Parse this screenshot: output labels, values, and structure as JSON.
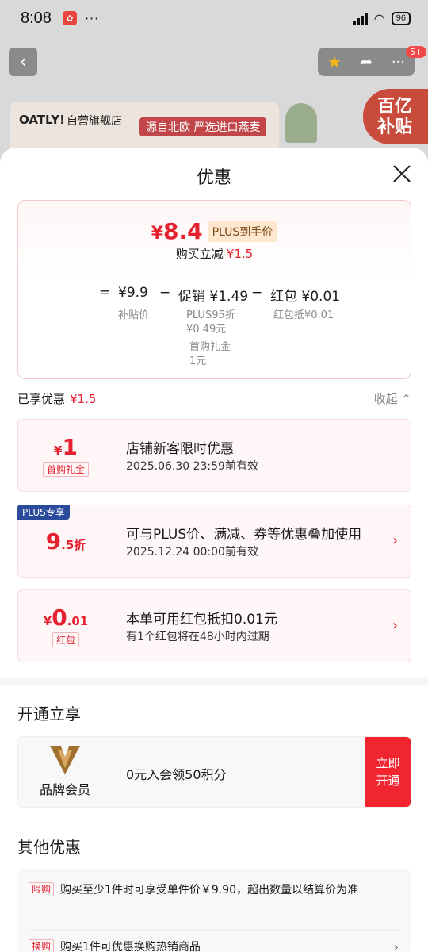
{
  "status": {
    "time": "8:08",
    "battery": "96"
  },
  "background": {
    "nav_badge": "5+",
    "brand_logo": "OATLY!",
    "store_name": "自营旗舰店",
    "slogan": "源自北欧 严选进口燕麦",
    "subsidy_line1": "百亿",
    "subsidy_line2": "补贴"
  },
  "sheet": {
    "title": "优惠"
  },
  "price": {
    "currency": "¥",
    "final": "8.4",
    "plus_tag": "PLUS到手价",
    "reduce_label": "购买立减",
    "reduce_amount": "¥1.5",
    "eq": "=",
    "base_value": "¥9.9",
    "base_label": "补贴价",
    "minus": "−",
    "promo_value": "促销 ¥1.49",
    "promo_sub1": "PLUS95折",
    "promo_sub2": "¥0.49元",
    "promo_sub3": "首购礼金",
    "promo_sub4": "1元",
    "redpacket_value": "红包 ¥0.01",
    "redpacket_label": "红包抵¥0.01"
  },
  "enjoyed": {
    "label": "已享优惠",
    "amount": "¥1.5",
    "collapse": "收起 ⌃"
  },
  "promos": [
    {
      "small": "¥",
      "big": "1",
      "tag": "首购礼金",
      "title": "店铺新客限时优惠",
      "desc": "2025.06.30 23:59前有效"
    },
    {
      "badge": "PLUS专享",
      "big": "9",
      "small": ".5折",
      "title": "可与PLUS价、满减、券等优惠叠加使用",
      "desc": "2025.12.24 00:00前有效"
    },
    {
      "small": "¥",
      "big": "0",
      "small2": ".01",
      "tag": "红包",
      "title": "本单可用红包抵扣0.01元",
      "desc": "有1个红包将在48小时内过期"
    }
  ],
  "membership": {
    "section_title": "开通立享",
    "label": "品牌会员",
    "text": "0元入会领50积分",
    "button_line1": "立即",
    "button_line2": "开通"
  },
  "other": {
    "section_title": "其他优惠",
    "items": [
      {
        "tag": "限购",
        "text": "购买至少1件时可享受单件价￥9.90，超出数量以结算价为准"
      },
      {
        "tag": "换购",
        "text": "购买1件可优惠换购热销商品"
      }
    ]
  }
}
